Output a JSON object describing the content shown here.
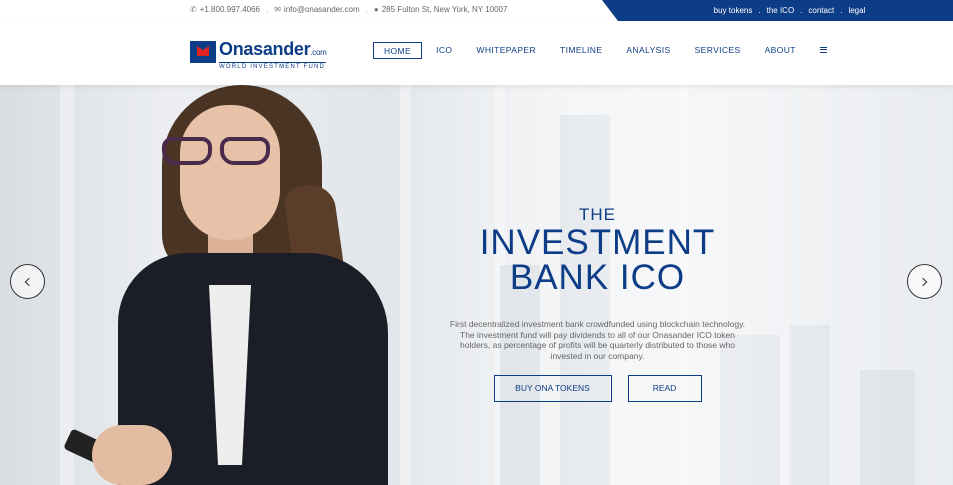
{
  "topbar": {
    "phone": "+1.800.997.4066",
    "email": "info@onasander.com",
    "address": "285 Fulton St, New York, NY 10007",
    "separator": ".",
    "links": [
      "buy tokens",
      "the ICO",
      "contact",
      "legal"
    ]
  },
  "logo": {
    "name": "Onasander",
    "suffix": ".com",
    "tagline": "WORLD INVESTMENT FUND"
  },
  "nav": {
    "items": [
      "HOME",
      "ICO",
      "WHITEPAPER",
      "TIMELINE",
      "ANALYSIS",
      "SERVICES",
      "ABOUT"
    ],
    "active": "HOME"
  },
  "hero": {
    "pre_title": "THE",
    "title_line1": "INVESTMENT",
    "title_line2": "BANK ICO",
    "description": "First decentralized investment bank crowdfunded using blockchain technology. The investment fund will pay dividends to all of our Onasander ICO token holders, as percentage of profits will be quarterly distributed to those who invested in our company.",
    "buy_button": "BUY ONA TOKENS",
    "read_button": "READ"
  },
  "colors": {
    "brand": "#0d3d86",
    "accent": "#d22222"
  },
  "icons": [
    "phone-icon",
    "envelope-icon",
    "map-marker-icon",
    "hamburger-menu-icon",
    "chevron-left-icon",
    "chevron-right-icon"
  ]
}
